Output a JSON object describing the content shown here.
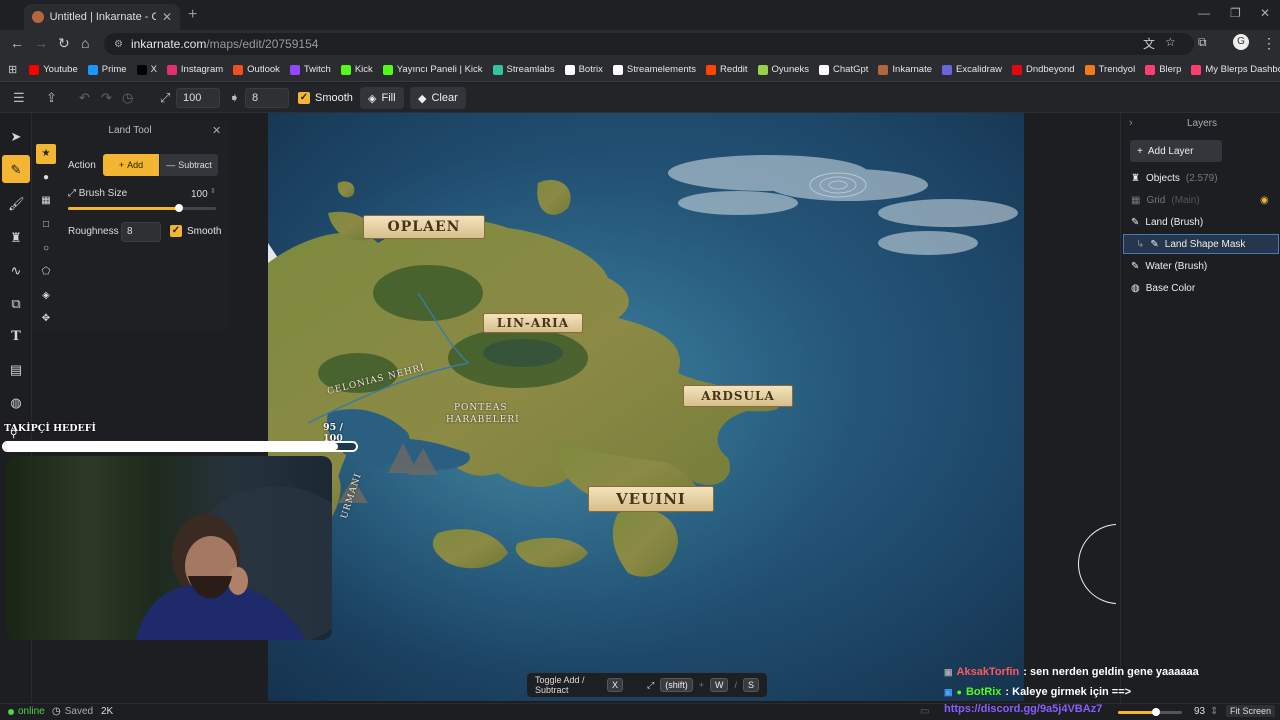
{
  "browser": {
    "tab_title": "Untitled | Inkarnate - Create Fa",
    "tab_close": "✕",
    "new_tab": "+",
    "url_host": "inkarnate.com",
    "url_path": "/maps/edit/20759154"
  },
  "bookmarks": [
    {
      "label": "Youtube",
      "color": "#ff0000"
    },
    {
      "label": "Prime",
      "color": "#1a98ff"
    },
    {
      "label": "X",
      "color": "#000000"
    },
    {
      "label": "Instagram",
      "color": "#e1306c"
    },
    {
      "label": "Outlook",
      "color": "#f25022"
    },
    {
      "label": "Twitch",
      "color": "#9146ff"
    },
    {
      "label": "Kick",
      "color": "#53fc18"
    },
    {
      "label": "Yayıncı Paneli | Kick",
      "color": "#53fc18"
    },
    {
      "label": "Streamlabs",
      "color": "#31c3a2"
    },
    {
      "label": "Botrix",
      "color": "#ffffff"
    },
    {
      "label": "Streamelements",
      "color": "#ffffff"
    },
    {
      "label": "Reddit",
      "color": "#ff4500"
    },
    {
      "label": "Oyuneks",
      "color": "#9ad14b"
    },
    {
      "label": "ChatGpt",
      "color": "#ffffff"
    },
    {
      "label": "Inkarnate",
      "color": "#b4673e"
    },
    {
      "label": "Excalidraw",
      "color": "#6965db"
    },
    {
      "label": "Dndbeyond",
      "color": "#e40712"
    },
    {
      "label": "Trendyol",
      "color": "#f27a1a"
    },
    {
      "label": "Blerp",
      "color": "#ff3d71"
    },
    {
      "label": "My Blerps Dashboard",
      "color": "#ff3d71"
    }
  ],
  "toolbar": {
    "brush_size": "100",
    "rotation": "8",
    "smooth_label": "Smooth",
    "fill_label": "Fill",
    "clear_label": "Clear"
  },
  "land_tool": {
    "title": "Land Tool",
    "action_label": "Action",
    "add_label": "Add",
    "subtract_label": "Subtract",
    "brush_size_label": "Brush Size",
    "brush_size_value": "100",
    "brush_fraction": 0.75,
    "roughness_label": "Roughness",
    "roughness_value": "8",
    "smooth_label": "Smooth"
  },
  "map_labels": {
    "oplaen": "OPLAEN",
    "linaria": "LIN-ARIA",
    "ardsula": "ARDSULA",
    "veuini": "VEUINI",
    "celonias": "CELONIAS NEHRİ",
    "ponteas1": "PONTEAS",
    "ponteas2": "HARABELERİ",
    "urmani": "URMANI"
  },
  "layers": {
    "title": "Layers",
    "add_layer": "Add Layer",
    "items": [
      {
        "label": "Objects",
        "extra": "(2.579)"
      },
      {
        "label": "Grid",
        "extra": "(Main)"
      },
      {
        "label": "Land (Brush)",
        "extra": ""
      },
      {
        "label": "Land Shape Mask",
        "extra": ""
      },
      {
        "label": "Water (Brush)",
        "extra": ""
      },
      {
        "label": "Base Color",
        "extra": ""
      }
    ]
  },
  "hint": {
    "text": "Toggle Add / Subtract",
    "key1": "X",
    "key2": "(shift)",
    "key3": "W",
    "sep": "/",
    "key4": "S"
  },
  "status": {
    "online": "online",
    "saved": "Saved",
    "count": "2K",
    "zoom": "93",
    "fit": "Fit Screen",
    "zoom_fraction": 0.6
  },
  "follower_goal": {
    "title": "TAKİPÇİ HEDEFİ",
    "count": "95 / 100",
    "fraction": 0.95
  },
  "chat": [
    {
      "user": "AksakTorfin",
      "text": ": sen nerden geldin gene yaaaaaa",
      "color": "#ff5a5a"
    },
    {
      "user": "BotRix",
      "text": ": Kaleye girmek için ==>",
      "color": "#53fc18"
    },
    {
      "user": "",
      "text": "https://discord.gg/9a5j4VBAz7",
      "color": "#8a5cff"
    }
  ]
}
